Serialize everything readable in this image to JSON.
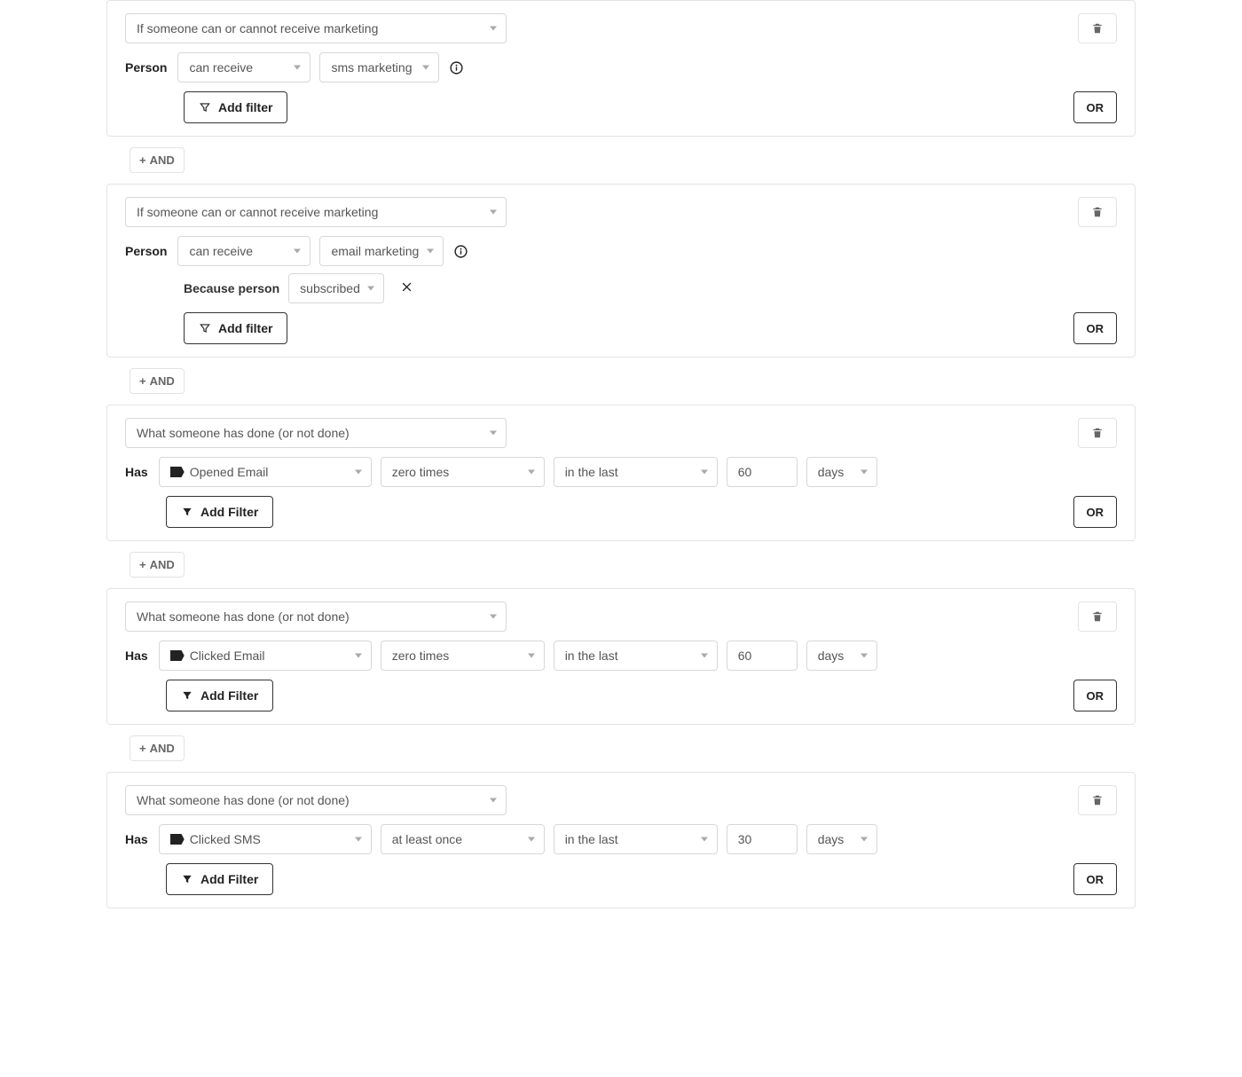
{
  "labels": {
    "and": "AND",
    "or": "OR",
    "person": "Person",
    "has": "Has",
    "because_person": "Because person",
    "add_filter": "Add filter",
    "add_filter_cap": "Add Filter"
  },
  "condition_types": {
    "marketing": "If someone can or cannot receive marketing",
    "activity": "What someone has done (or not done)"
  },
  "blocks": [
    {
      "type_label": "If someone can or cannot receive marketing",
      "prefix": "Person",
      "selects": [
        {
          "value": "can receive"
        },
        {
          "value": "sms marketing"
        }
      ],
      "info": true,
      "sub": null,
      "add_filter_style": "outline",
      "add_filter_label": "Add filter"
    },
    {
      "type_label": "If someone can or cannot receive marketing",
      "prefix": "Person",
      "selects": [
        {
          "value": "can receive"
        },
        {
          "value": "email marketing"
        }
      ],
      "info": true,
      "sub": {
        "label": "Because person",
        "value": "subscribed",
        "remove": true
      },
      "add_filter_style": "outline",
      "add_filter_label": "Add filter"
    },
    {
      "type_label": "What someone has done (or not done)",
      "prefix": "Has",
      "metric": {
        "name": "Opened Email"
      },
      "op": "zero times",
      "timeframe": "in the last",
      "number": "60",
      "unit": "days",
      "add_filter_style": "solid",
      "add_filter_label": "Add Filter"
    },
    {
      "type_label": "What someone has done (or not done)",
      "prefix": "Has",
      "metric": {
        "name": "Clicked Email"
      },
      "op": "zero times",
      "timeframe": "in the last",
      "number": "60",
      "unit": "days",
      "add_filter_style": "solid",
      "add_filter_label": "Add Filter"
    },
    {
      "type_label": "What someone has done (or not done)",
      "prefix": "Has",
      "metric": {
        "name": "Clicked SMS"
      },
      "op": "at least once",
      "timeframe": "in the last",
      "number": "30",
      "unit": "days",
      "add_filter_style": "solid",
      "add_filter_label": "Add Filter"
    }
  ]
}
